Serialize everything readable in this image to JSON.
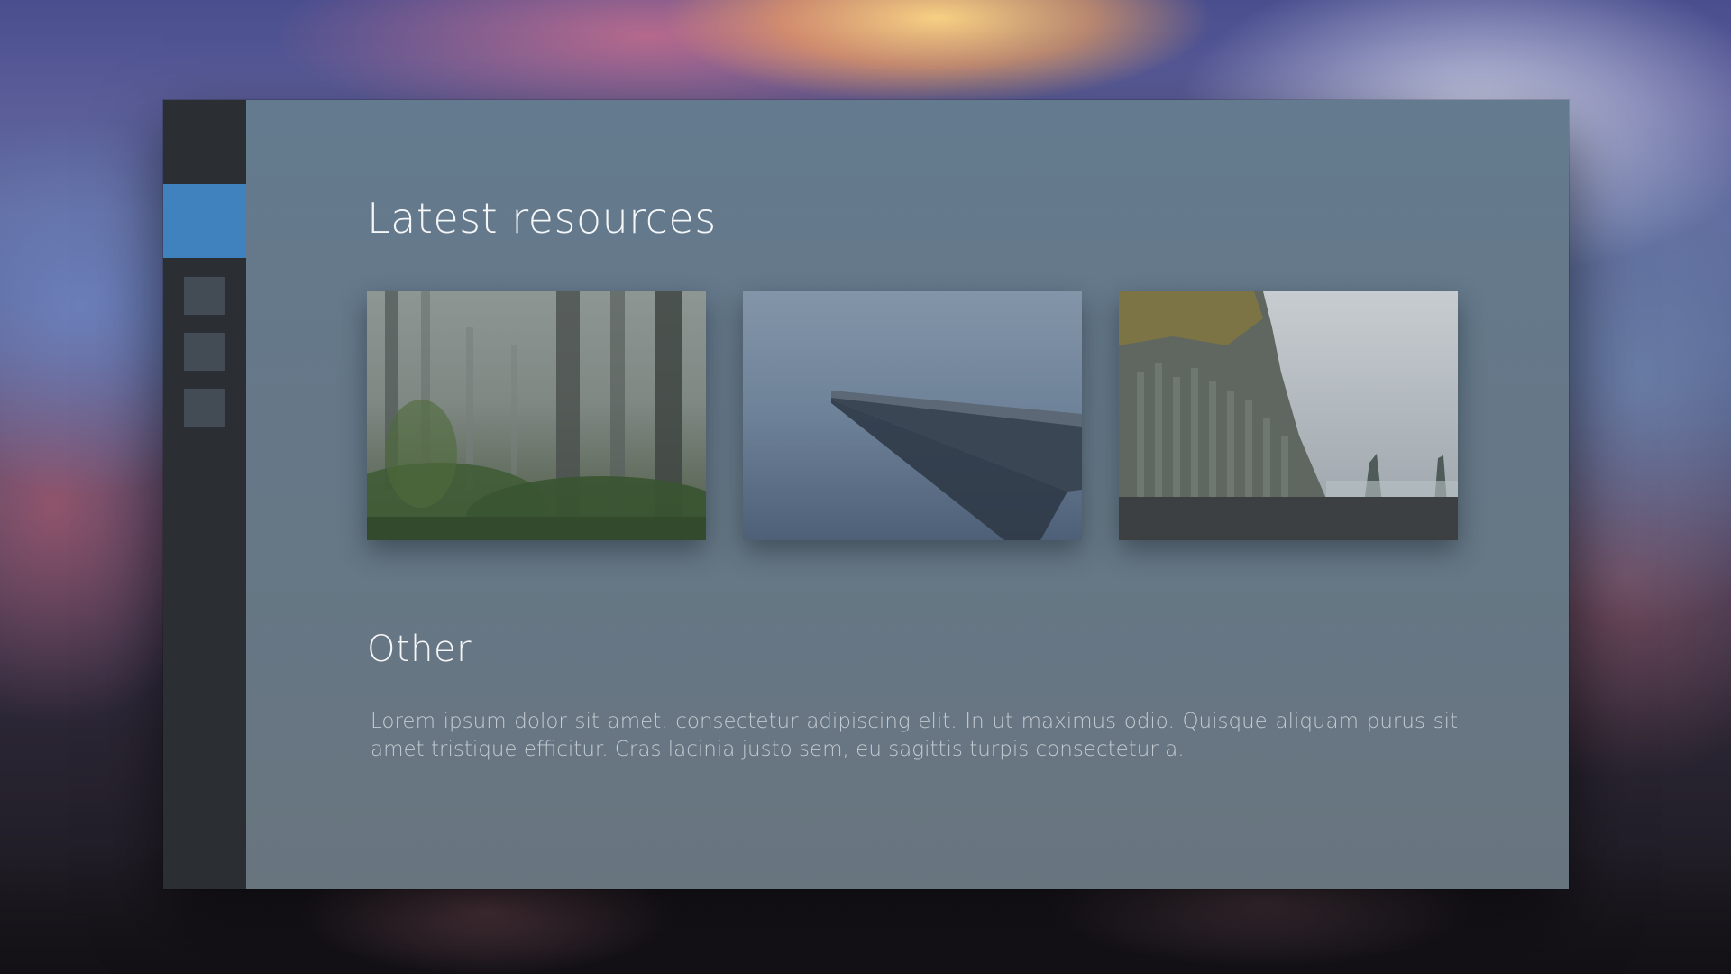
{
  "sidebar": {
    "accent_color": "#3f82bd",
    "items": [
      {
        "name": "nav-item-1"
      },
      {
        "name": "nav-item-2"
      },
      {
        "name": "nav-item-3"
      }
    ]
  },
  "main": {
    "latest_title": "Latest resources",
    "resources": [
      {
        "subject": "misty-forest"
      },
      {
        "subject": "pier-in-fog"
      },
      {
        "subject": "basalt-cliff-coast"
      }
    ],
    "other_title": "Other",
    "other_text": "Lorem ipsum dolor sit amet, consectetur adipiscing elit. In ut maximus odio. Quisque aliquam purus sit amet tristique efficitur. Cras lacinia justo sem, eu sagittis turpis consectetur a."
  }
}
